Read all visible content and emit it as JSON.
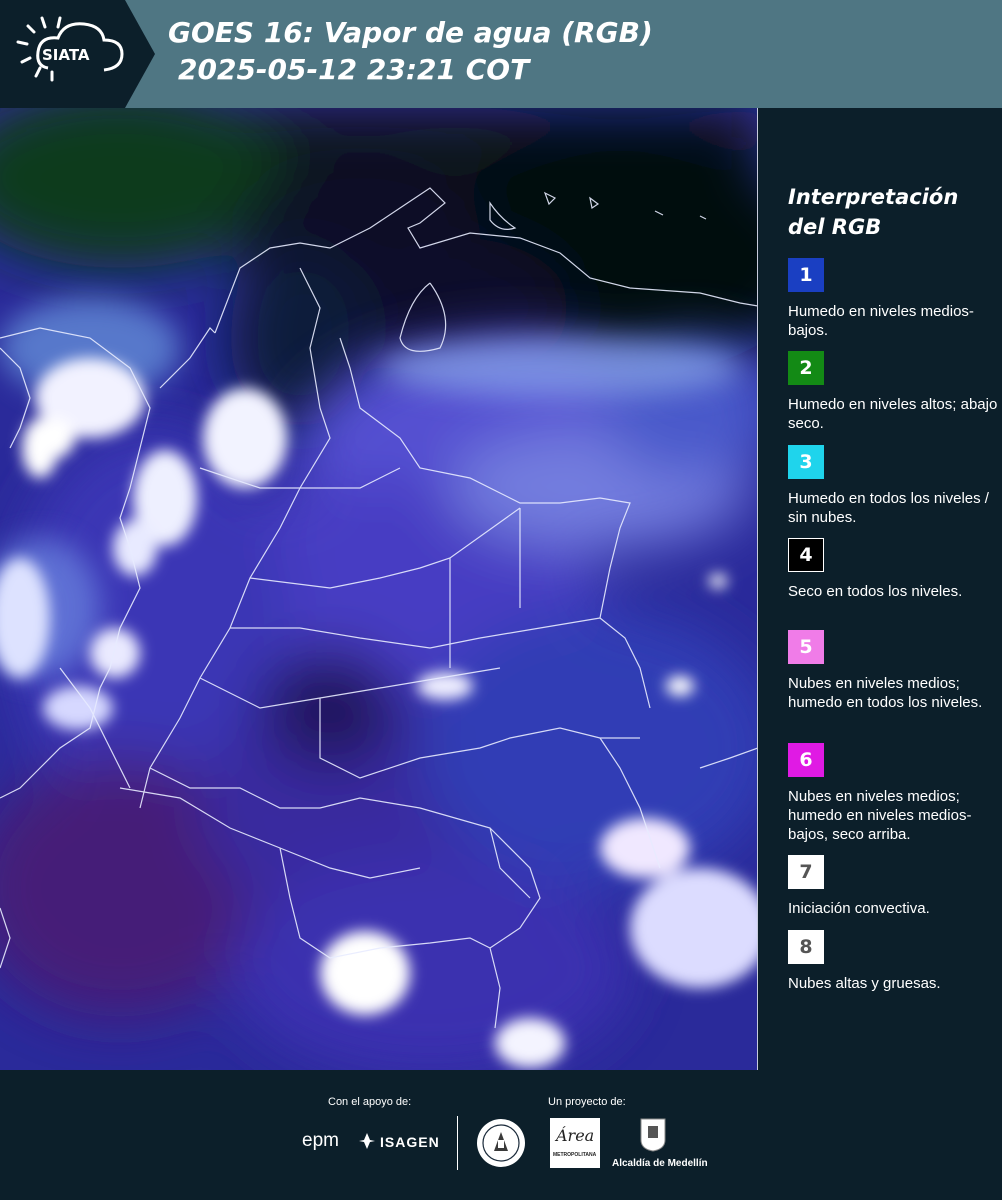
{
  "header": {
    "logo_text": "SIATA",
    "title_line1": "GOES 16: Vapor de agua (RGB)",
    "title_line2": "2025-05-12 23:21 COT"
  },
  "legend": {
    "title": "Interpretación del RGB",
    "items": [
      {
        "number": "1",
        "color": "#1a3fc2",
        "text": "Humedo en niveles medios-bajos."
      },
      {
        "number": "2",
        "color": "#138a15",
        "text": "Humedo en niveles altos; abajo seco."
      },
      {
        "number": "3",
        "color": "#1fd4ec",
        "text": "Humedo en todos los niveles / sin nubes."
      },
      {
        "number": "4",
        "color": "#000000",
        "text": "Seco en todos los niveles."
      },
      {
        "number": "5",
        "color": "#f07ce8",
        "text": "Nubes en niveles medios; humedo en todos los niveles."
      },
      {
        "number": "6",
        "color": "#e01ae4",
        "text": "Nubes en niveles medios; humedo en niveles medios-bajos, seco arriba."
      },
      {
        "number": "7",
        "color": "#ffffff",
        "text": "Iniciación convectiva."
      },
      {
        "number": "8",
        "color": "#ffffff",
        "text": "Nubes altas y gruesas."
      }
    ]
  },
  "footer": {
    "support_label": "Con el apoyo de:",
    "project_label": "Un proyecto de:",
    "sponsor1": "epm",
    "sponsor2": "ISAGEN",
    "partner_area": "Área",
    "partner_area_sub": "METROPOLITANA",
    "partner_alcaldia": "Alcaldía de Medellín"
  }
}
